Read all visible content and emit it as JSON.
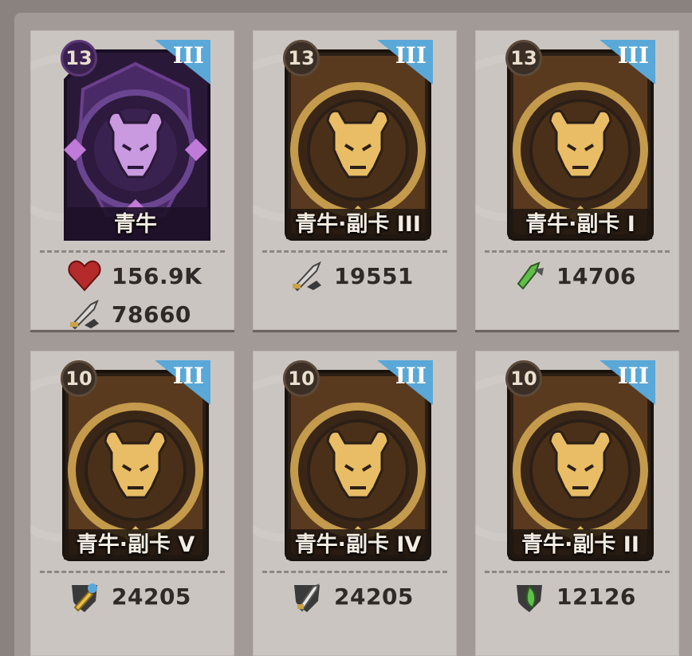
{
  "cards": [
    {
      "level": "13",
      "tier": "III",
      "name": "青牛",
      "style": "main",
      "stats": [
        {
          "icon": "heart-icon",
          "value": "156.9K"
        },
        {
          "icon": "crossed-swords-icon",
          "value": "78660"
        }
      ]
    },
    {
      "level": "13",
      "tier": "III",
      "name": "青牛·副卡 III",
      "style": "sub",
      "stats": [
        {
          "icon": "crossed-swords-icon",
          "value": "19551"
        }
      ]
    },
    {
      "level": "13",
      "tier": "III",
      "name": "青牛·副卡 I",
      "style": "sub",
      "stats": [
        {
          "icon": "green-blade-icon",
          "value": "14706"
        }
      ]
    },
    {
      "level": "10",
      "tier": "III",
      "name": "青牛·副卡 V",
      "style": "sub",
      "stats": [
        {
          "icon": "hammer-shield-icon",
          "value": "24205"
        }
      ]
    },
    {
      "level": "10",
      "tier": "III",
      "name": "青牛·副卡 IV",
      "style": "sub",
      "stats": [
        {
          "icon": "sword-shield-icon",
          "value": "24205"
        }
      ]
    },
    {
      "level": "10",
      "tier": "III",
      "name": "青牛·副卡 II",
      "style": "sub",
      "stats": [
        {
          "icon": "green-leaf-shield-icon",
          "value": "12126"
        }
      ]
    }
  ],
  "colors": {
    "purple_card": "#4a2a66",
    "gold_card": "#5a3a1e",
    "tier_badge": "#5aa8d8",
    "stat_text": "#2f2a28"
  }
}
